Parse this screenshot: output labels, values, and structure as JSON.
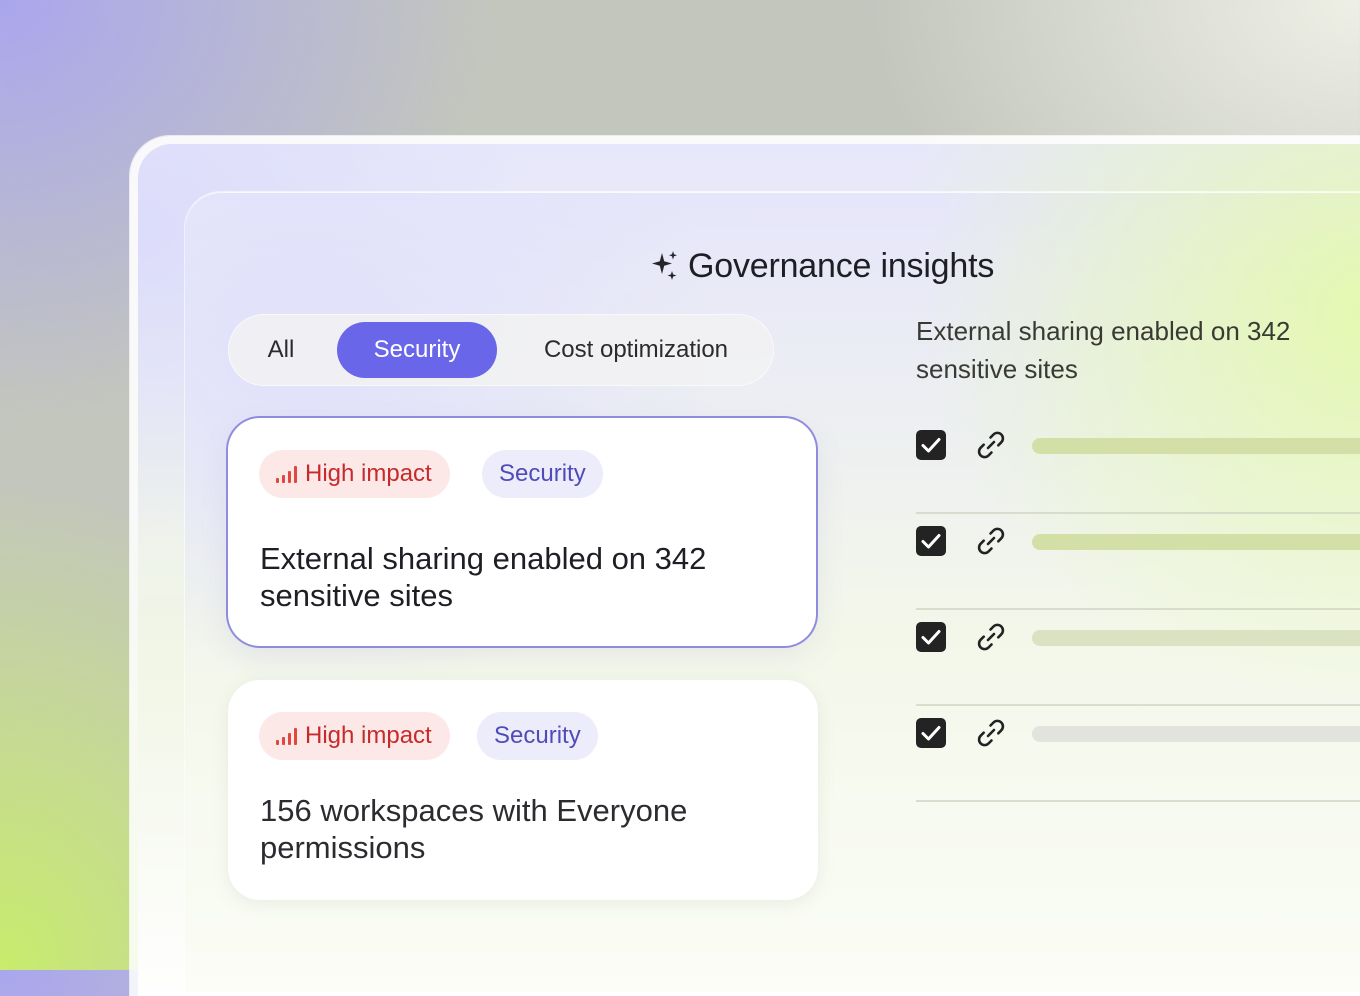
{
  "header": {
    "title": "Governance insights",
    "title_icon": "sparkle-icon"
  },
  "tabs": [
    {
      "label": "All",
      "active": false
    },
    {
      "label": "Security",
      "active": true
    },
    {
      "label": "Cost optimization",
      "active": false
    }
  ],
  "cards": [
    {
      "impact_label": "High impact",
      "impact_icon": "signal-bars-icon",
      "tag_label": "Security",
      "text": "External sharing enabled on 342 sensitive sites",
      "selected": true
    },
    {
      "impact_label": "High impact",
      "impact_icon": "signal-bars-icon",
      "tag_label": "Security",
      "text": "156 workspaces with Everyone permissions",
      "selected": false
    }
  ],
  "detail": {
    "title": "External sharing enabled on 342 sensitive sites",
    "rows": [
      {
        "checked": true,
        "icon": "link-icon"
      },
      {
        "checked": true,
        "icon": "link-icon"
      },
      {
        "checked": true,
        "icon": "link-icon"
      },
      {
        "checked": true,
        "icon": "link-icon"
      }
    ]
  },
  "colors": {
    "accent": "#6a66ea",
    "impact_bg": "#fde8e8",
    "impact_text": "#c62a2a",
    "tag_bg": "#ececfb",
    "tag_text": "#4f4cb9"
  }
}
